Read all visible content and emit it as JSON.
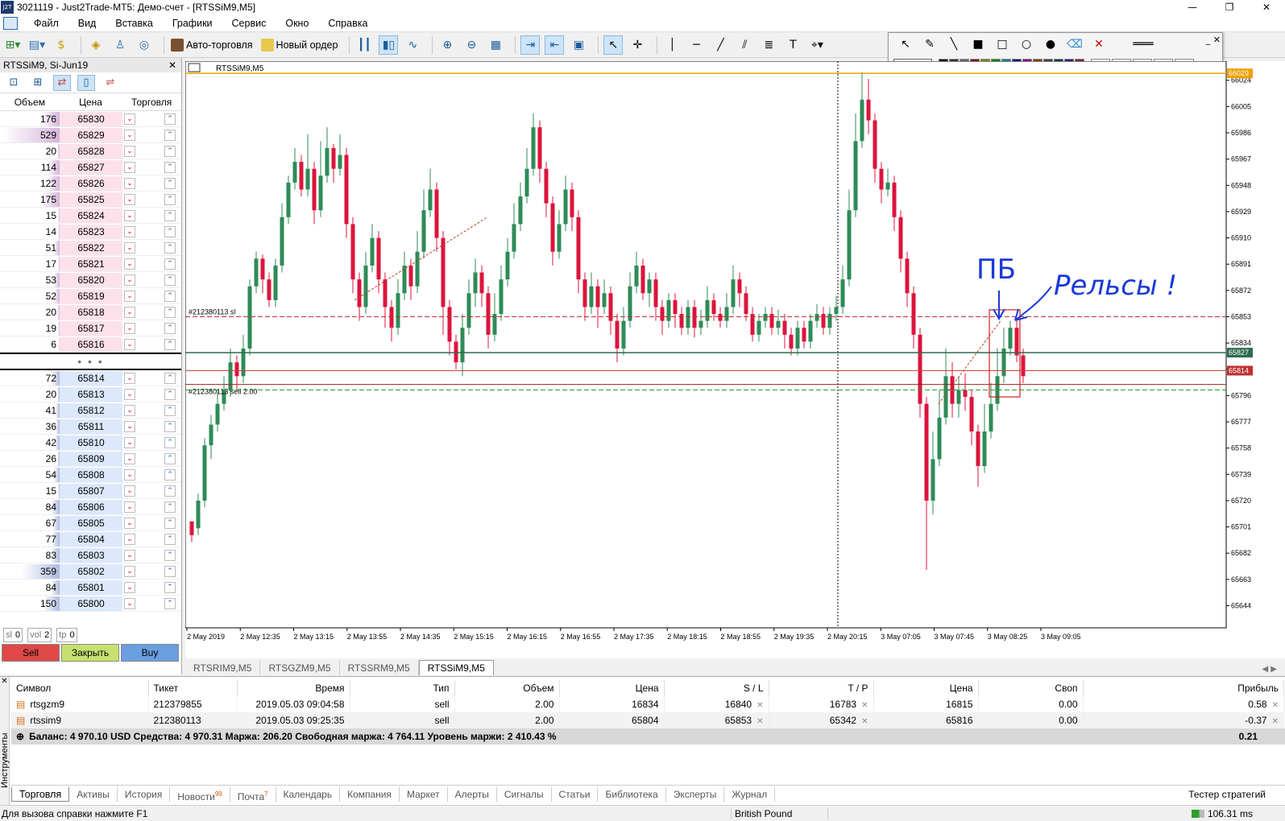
{
  "window": {
    "title": "3021119 - Just2Trade-MT5: Демо-счет - [RTSSiM9,M5]",
    "logo": "J2T"
  },
  "menu": [
    "Файл",
    "Вид",
    "Вставка",
    "Графики",
    "Сервис",
    "Окно",
    "Справка"
  ],
  "toolbar": {
    "auto_trading": "Авто-торговля",
    "new_order": "Новый ордер"
  },
  "dom": {
    "header": "RTSSiM9, Si-Jun19",
    "cols": {
      "volume": "Объем",
      "price": "Цена",
      "trade": "Торговля"
    },
    "asks": [
      {
        "volume": "176",
        "price": "65830",
        "level": 176
      },
      {
        "volume": "529",
        "price": "65829",
        "level": 529
      },
      {
        "volume": "20",
        "price": "65828",
        "level": 20
      },
      {
        "volume": "114",
        "price": "65827",
        "level": 114
      },
      {
        "volume": "122",
        "price": "65826",
        "level": 122
      },
      {
        "volume": "175",
        "price": "65825",
        "level": 175
      },
      {
        "volume": "15",
        "price": "65824",
        "level": 15
      },
      {
        "volume": "14",
        "price": "65823",
        "level": 14
      },
      {
        "volume": "51",
        "price": "65822",
        "level": 51
      },
      {
        "volume": "17",
        "price": "65821",
        "level": 17
      },
      {
        "volume": "53",
        "price": "65820",
        "level": 53
      },
      {
        "volume": "52",
        "price": "65819",
        "level": 52
      },
      {
        "volume": "20",
        "price": "65818",
        "level": 20
      },
      {
        "volume": "19",
        "price": "65817",
        "level": 19
      },
      {
        "volume": "6",
        "price": "65816",
        "level": 6
      }
    ],
    "separator": "• • •",
    "bids": [
      {
        "volume": "72",
        "price": "65814",
        "level": 72
      },
      {
        "volume": "20",
        "price": "65813",
        "level": 20
      },
      {
        "volume": "41",
        "price": "65812",
        "level": 41
      },
      {
        "volume": "36",
        "price": "65811",
        "level": 36
      },
      {
        "volume": "42",
        "price": "65810",
        "level": 42
      },
      {
        "volume": "26",
        "price": "65809",
        "level": 26
      },
      {
        "volume": "54",
        "price": "65808",
        "level": 54
      },
      {
        "volume": "15",
        "price": "65807",
        "level": 15
      },
      {
        "volume": "84",
        "price": "65806",
        "level": 84
      },
      {
        "volume": "67",
        "price": "65805",
        "level": 67
      },
      {
        "volume": "77",
        "price": "65804",
        "level": 77
      },
      {
        "volume": "83",
        "price": "65803",
        "level": 83
      },
      {
        "volume": "359",
        "price": "65802",
        "level": 359
      },
      {
        "volume": "84",
        "price": "65801",
        "level": 84
      },
      {
        "volume": "150",
        "price": "65800",
        "level": 150
      }
    ],
    "controls": {
      "sl_label": "sl",
      "sl_value": "0",
      "vol_label": "vol",
      "vol_value": "2",
      "tp_label": "tp",
      "tp_value": "0"
    },
    "buttons": {
      "sell": "Sell",
      "close": "Закрыть",
      "buy": "Buy"
    },
    "colors": {
      "sell": "#e04848",
      "close": "#c8e070",
      "buy": "#6a9ee0"
    }
  },
  "chart": {
    "label": "RTSSiM9,M5",
    "sl_label": "#212380113 sl",
    "order_label": "#212380113 sell 2.00",
    "price_labels": {
      "top": "66029",
      "bid": "65827",
      "ask": "65814"
    },
    "annotations": {
      "pb": "ПБ",
      "rails": "Рельсы !"
    }
  },
  "chart_data": {
    "type": "candlestick",
    "symbol": "RTSSiM9",
    "timeframe": "M5",
    "y_ticks": [
      66024,
      66005,
      65986,
      65967,
      65948,
      65929,
      65910,
      65891,
      65872,
      65853,
      65834,
      65815,
      65796,
      65777,
      65758,
      65739,
      65720,
      65701,
      65682,
      65663,
      65644
    ],
    "x_ticks": [
      "2 May 2019",
      "2 May 12:35",
      "2 May 13:15",
      "2 May 13:55",
      "2 May 14:35",
      "2 May 15:15",
      "2 May 16:15",
      "2 May 16:55",
      "2 May 17:35",
      "2 May 18:15",
      "2 May 18:55",
      "2 May 19:35",
      "2 May 20:15",
      "3 May 07:05",
      "3 May 07:45",
      "3 May 08:25",
      "3 May 09:05"
    ],
    "levels": {
      "top_line": 66029,
      "stop_loss": 65853,
      "bid": 65827,
      "ask": 65814,
      "sell_order": 65804,
      "tp_line": 65800
    },
    "ylim": [
      65628,
      66032
    ],
    "candles": [
      [
        65705,
        65695,
        65700,
        65690
      ],
      [
        65700,
        65720,
        65725,
        65695
      ],
      [
        65720,
        65760,
        65765,
        65715
      ],
      [
        65760,
        65775,
        65782,
        65750
      ],
      [
        65775,
        65790,
        65800,
        65770
      ],
      [
        65790,
        65800,
        65810,
        65785
      ],
      [
        65800,
        65820,
        65830,
        65795
      ],
      [
        65820,
        65810,
        65825,
        65800
      ],
      [
        65810,
        65830,
        65840,
        65805
      ],
      [
        65830,
        65875,
        65880,
        65825
      ],
      [
        65875,
        65895,
        65900,
        65870
      ],
      [
        65895,
        65880,
        65898,
        65870
      ],
      [
        65880,
        65865,
        65885,
        65860
      ],
      [
        65865,
        65890,
        65895,
        65860
      ],
      [
        65890,
        65925,
        65935,
        65885
      ],
      [
        65925,
        65950,
        65955,
        65920
      ],
      [
        65950,
        65965,
        65975,
        65945
      ],
      [
        65965,
        65945,
        65970,
        65940
      ],
      [
        65945,
        65960,
        65985,
        65940
      ],
      [
        65960,
        65930,
        65965,
        65920
      ],
      [
        65930,
        65955,
        65980,
        65925
      ],
      [
        65955,
        65975,
        65990,
        65950
      ],
      [
        65975,
        65960,
        65978,
        65950
      ],
      [
        65960,
        65970,
        65985,
        65955
      ],
      [
        65970,
        65920,
        65975,
        65910
      ],
      [
        65920,
        65880,
        65925,
        65870
      ],
      [
        65880,
        65860,
        65885,
        65850
      ],
      [
        65860,
        65890,
        65900,
        65855
      ],
      [
        65890,
        65910,
        65920,
        65885
      ],
      [
        65910,
        65880,
        65915,
        65870
      ],
      [
        65880,
        65860,
        65885,
        65845
      ],
      [
        65860,
        65845,
        65865,
        65835
      ],
      [
        65845,
        65870,
        65880,
        65840
      ],
      [
        65870,
        65890,
        65900,
        65865
      ],
      [
        65890,
        65875,
        65895,
        65865
      ],
      [
        65875,
        65900,
        65915,
        65870
      ],
      [
        65900,
        65930,
        65945,
        65895
      ],
      [
        65930,
        65945,
        65960,
        65925
      ],
      [
        65945,
        65910,
        65950,
        65900
      ],
      [
        65910,
        65860,
        65915,
        65840
      ],
      [
        65860,
        65835,
        65865,
        65825
      ],
      [
        65835,
        65820,
        65840,
        65815
      ],
      [
        65820,
        65845,
        65855,
        65810
      ],
      [
        65845,
        65870,
        65880,
        65840
      ],
      [
        65870,
        65885,
        65895,
        65860
      ],
      [
        65885,
        65870,
        65890,
        65860
      ],
      [
        65870,
        65840,
        65875,
        65830
      ],
      [
        65840,
        65855,
        65870,
        65835
      ],
      [
        65855,
        65880,
        65890,
        65850
      ],
      [
        65880,
        65900,
        65910,
        65875
      ],
      [
        65900,
        65920,
        65935,
        65895
      ],
      [
        65920,
        65940,
        65950,
        65915
      ],
      [
        65940,
        65960,
        65975,
        65935
      ],
      [
        65960,
        65990,
        66000,
        65955
      ],
      [
        65990,
        65960,
        65995,
        65950
      ],
      [
        65960,
        65935,
        65965,
        65925
      ],
      [
        65935,
        65900,
        65940,
        65890
      ],
      [
        65900,
        65920,
        65930,
        65895
      ],
      [
        65920,
        65945,
        65955,
        65915
      ],
      [
        65945,
        65925,
        65950,
        65915
      ],
      [
        65925,
        65880,
        65930,
        65870
      ],
      [
        65880,
        65860,
        65885,
        65850
      ],
      [
        65860,
        65875,
        65885,
        65855
      ],
      [
        65875,
        65860,
        65880,
        65845
      ],
      [
        65860,
        65870,
        65880,
        65855
      ],
      [
        65870,
        65850,
        65875,
        65840
      ],
      [
        65850,
        65830,
        65855,
        65820
      ],
      [
        65830,
        65850,
        65860,
        65825
      ],
      [
        65850,
        65875,
        65885,
        65845
      ],
      [
        65875,
        65890,
        65900,
        65870
      ],
      [
        65890,
        65870,
        65895,
        65865
      ],
      [
        65870,
        65880,
        65885,
        65860
      ],
      [
        65880,
        65860,
        65885,
        65850
      ],
      [
        65860,
        65850,
        65865,
        65840
      ],
      [
        65850,
        65865,
        65870,
        65845
      ],
      [
        65865,
        65855,
        65870,
        65845
      ],
      [
        65855,
        65845,
        65860,
        65840
      ],
      [
        65845,
        65860,
        65865,
        65840
      ],
      [
        65860,
        65845,
        65865,
        65838
      ],
      [
        65845,
        65850,
        65858,
        65840
      ],
      [
        65850,
        65865,
        65875,
        65845
      ],
      [
        65865,
        65855,
        65870,
        65850
      ],
      [
        65855,
        65850,
        65860,
        65845
      ],
      [
        65850,
        65860,
        65870,
        65845
      ],
      [
        65860,
        65880,
        65890,
        65855
      ],
      [
        65880,
        65870,
        65885,
        65860
      ],
      [
        65870,
        65855,
        65875,
        65850
      ],
      [
        65855,
        65840,
        65860,
        65835
      ],
      [
        65840,
        65850,
        65855,
        65835
      ],
      [
        65850,
        65855,
        65860,
        65845
      ],
      [
        65855,
        65845,
        65860,
        65840
      ],
      [
        65845,
        65850,
        65858,
        65840
      ],
      [
        65850,
        65840,
        65855,
        65830
      ],
      [
        65840,
        65830,
        65845,
        65825
      ],
      [
        65830,
        65845,
        65850,
        65825
      ],
      [
        65845,
        65835,
        65850,
        65830
      ],
      [
        65835,
        65850,
        65855,
        65830
      ],
      [
        65850,
        65855,
        65862,
        65845
      ],
      [
        65855,
        65845,
        65860,
        65840
      ],
      [
        65845,
        65855,
        65860,
        65840
      ],
      [
        65855,
        65860,
        65868,
        65850
      ],
      [
        65860,
        65880,
        65890,
        65855
      ],
      [
        65880,
        65930,
        65945,
        65875
      ],
      [
        65930,
        65980,
        66000,
        65925
      ],
      [
        65980,
        66010,
        66030,
        65975
      ],
      [
        66010,
        65995,
        66025,
        65985
      ],
      [
        65995,
        65960,
        66000,
        65950
      ],
      [
        65960,
        65945,
        65965,
        65935
      ],
      [
        65945,
        65950,
        65960,
        65940
      ],
      [
        65950,
        65925,
        65955,
        65915
      ],
      [
        65925,
        65895,
        65930,
        65885
      ],
      [
        65895,
        65870,
        65900,
        65860
      ],
      [
        65870,
        65840,
        65875,
        65830
      ],
      [
        65840,
        65790,
        65845,
        65780
      ],
      [
        65790,
        65720,
        65795,
        65670
      ],
      [
        65720,
        65750,
        65770,
        65710
      ],
      [
        65750,
        65780,
        65800,
        65745
      ],
      [
        65780,
        65810,
        65830,
        65775
      ],
      [
        65810,
        65790,
        65820,
        65780
      ],
      [
        65790,
        65800,
        65810,
        65780
      ],
      [
        65800,
        65795,
        65812,
        65785
      ],
      [
        65795,
        65770,
        65800,
        65760
      ],
      [
        65770,
        65745,
        65775,
        65730
      ],
      [
        65745,
        65770,
        65790,
        65740
      ],
      [
        65770,
        65790,
        65805,
        65765
      ],
      [
        65790,
        65810,
        65830,
        65785
      ],
      [
        65810,
        65830,
        65845,
        65805
      ],
      [
        65830,
        65845,
        65850,
        65825
      ],
      [
        65845,
        65825,
        65850,
        65820
      ],
      [
        65825,
        65810,
        65830,
        65805
      ]
    ]
  },
  "chart_tabs": [
    "RTSRIM9,M5",
    "RTSGZM9,M5",
    "RTSSRM9,M5",
    "RTSSiM9,M5"
  ],
  "positions": {
    "columns": [
      "Символ",
      "Тикет",
      "Время",
      "Тип",
      "Объем",
      "Цена",
      "S / L",
      "T / P",
      "Цена",
      "Своп",
      "Прибыль"
    ],
    "rows": [
      {
        "symbol": "rtsgzm9",
        "ticket": "212379855",
        "time": "2019.05.03 09:04:58",
        "type": "sell",
        "volume": "2.00",
        "price": "16834",
        "sl": "16840",
        "tp": "16783",
        "cur": "16815",
        "swap": "0.00",
        "profit": "0.58"
      },
      {
        "symbol": "rtssim9",
        "ticket": "212380113",
        "time": "2019.05.03 09:25:35",
        "type": "sell",
        "volume": "2.00",
        "price": "65804",
        "sl": "65853",
        "tp": "65342",
        "cur": "65816",
        "swap": "0.00",
        "profit": "-0.37"
      }
    ],
    "balance": "Баланс: 4 970.10 USD  Средства: 4 970.31  Маржа: 206.20  Свободная маржа: 4 764.11  Уровень маржи: 2 410.43 %",
    "total_profit": "0.21"
  },
  "terminal_side": "Инструменты",
  "terminal_tabs": [
    {
      "label": "Торговля",
      "badge": ""
    },
    {
      "label": "Активы",
      "badge": ""
    },
    {
      "label": "История",
      "badge": ""
    },
    {
      "label": "Новости",
      "badge": "99"
    },
    {
      "label": "Почта",
      "badge": "7"
    },
    {
      "label": "Календарь",
      "badge": ""
    },
    {
      "label": "Компания",
      "badge": ""
    },
    {
      "label": "Маркет",
      "badge": ""
    },
    {
      "label": "Алерты",
      "badge": ""
    },
    {
      "label": "Сигналы",
      "badge": ""
    },
    {
      "label": "Статьи",
      "badge": ""
    },
    {
      "label": "Библиотека",
      "badge": ""
    },
    {
      "label": "Эксперты",
      "badge": ""
    },
    {
      "label": "Журнал",
      "badge": ""
    }
  ],
  "strategy_tester": "Тестер стратегий",
  "status": {
    "help": "Для вызова справки нажмите F1",
    "profile": "British Pound",
    "ping": "106.31 ms"
  }
}
